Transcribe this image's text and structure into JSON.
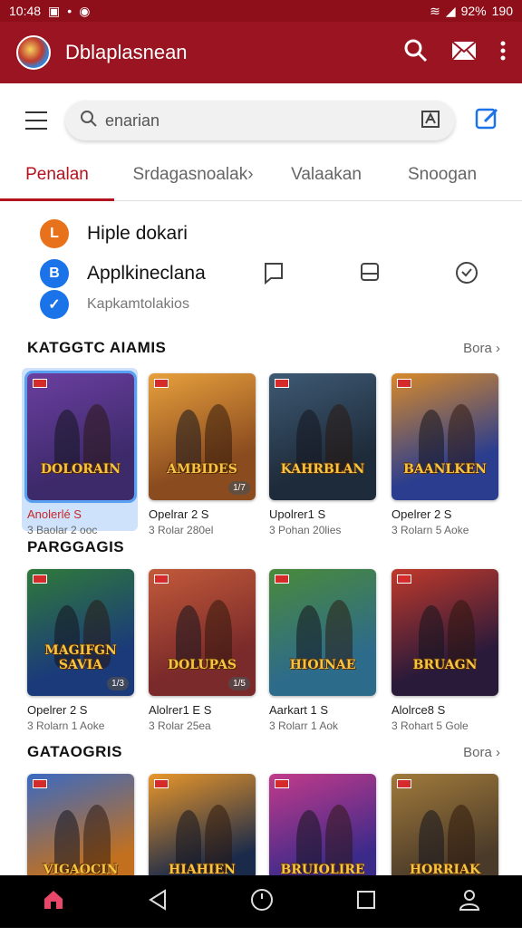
{
  "status": {
    "time": "10:48",
    "battery": "92%",
    "extra": "190"
  },
  "app": {
    "title": "Dblaplasnean"
  },
  "search": {
    "placeholder": "enarian"
  },
  "tabs": [
    {
      "label": "Penalan"
    },
    {
      "label": "Srdagasnoalak›"
    },
    {
      "label": "Valaakan"
    },
    {
      "label": "Snoogan"
    }
  ],
  "accounts": {
    "first": {
      "label": "Hiple dokari",
      "icon_letter": "L"
    },
    "second": {
      "label": "Applkineclana",
      "icon_letter": "B"
    },
    "third": {
      "label": "Kapkamtolakios",
      "icon_letter": "✓"
    }
  },
  "sections": [
    {
      "title": "KATGGTC AIAMIS",
      "more": "Bora ›"
    },
    {
      "title": "PARGGAGIS",
      "more": ""
    },
    {
      "title": "GATAOGRIS",
      "more": "Bora ›"
    }
  ],
  "row1": [
    {
      "title": "Anolerlé S",
      "sub": "3 Baolar 2 ooc",
      "art": "DOLORAIN",
      "count": "",
      "bg": "#3d2a6b",
      "accent": "#6b3fa0"
    },
    {
      "title": "Opelrar 2 S",
      "sub": "3 Rolar 280el",
      "art": "AMBIDES",
      "count": "1/7",
      "bg": "#8a4b1f",
      "accent": "#e8a03c"
    },
    {
      "title": "Upolrer1 S",
      "sub": "3 Pohan 20lies",
      "art": "KAHRBLAN",
      "count": "",
      "bg": "#1e2b3a",
      "accent": "#3e5a74"
    },
    {
      "title": "Opelrer 2 S",
      "sub": "3 Rolarn 5 Aoke",
      "art": "BAANLKEN",
      "count": "",
      "bg": "#2a3d8f",
      "accent": "#d88a2a"
    }
  ],
  "row2": [
    {
      "title": "Opelrer 2 S",
      "sub": "3 Rolarn 1 Aoke",
      "art": "MAGIFGN SAVIA",
      "count": "1/3",
      "bg": "#1b3a7a",
      "accent": "#2f7a3a"
    },
    {
      "title": "Alolrer1 E S",
      "sub": "3 Rolar 25ea",
      "art": "DOLUPAS",
      "count": "1/5",
      "bg": "#7a2a2a",
      "accent": "#c25a3a"
    },
    {
      "title": "Aarkart 1 S",
      "sub": "3 Rolarr 1 Aok",
      "art": "HIOINAE",
      "count": "",
      "bg": "#2d6b8a",
      "accent": "#4a8a3a"
    },
    {
      "title": "Alolrce8 S",
      "sub": "3 Rohart 5 Gole",
      "art": "BRUAGN",
      "count": "",
      "bg": "#2a1a3a",
      "accent": "#c0392b"
    }
  ],
  "row3": [
    {
      "title": "",
      "sub": "",
      "art": "VIGAOCIN",
      "count": "",
      "bg": "#c2701e",
      "accent": "#3a6ac2"
    },
    {
      "title": "",
      "sub": "",
      "art": "HIAHIEN",
      "count": "",
      "bg": "#1a2a4a",
      "accent": "#e8962a"
    },
    {
      "title": "",
      "sub": "",
      "art": "BRUIOLIRE",
      "count": "",
      "bg": "#3a2a8a",
      "accent": "#c23a8a"
    },
    {
      "title": "",
      "sub": "",
      "art": "HORRIAK",
      "count": "",
      "bg": "#4a3a2a",
      "accent": "#a07a3a"
    }
  ]
}
